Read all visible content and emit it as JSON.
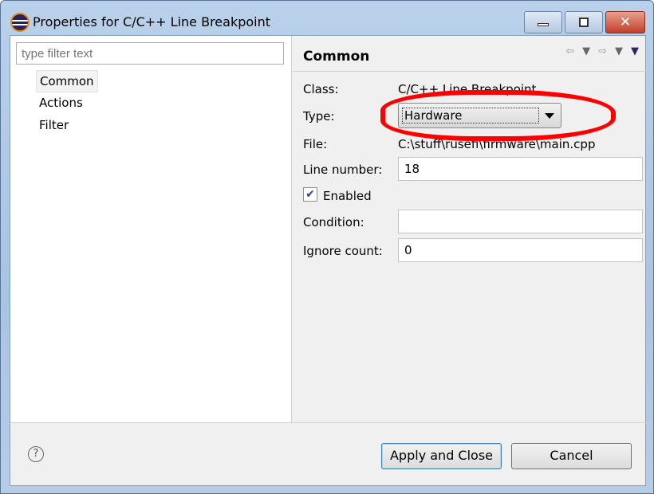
{
  "window": {
    "title": "Properties for C/C++ Line Breakpoint"
  },
  "left": {
    "filter_placeholder": "type filter text",
    "items": [
      "Common",
      "Actions",
      "Filter"
    ],
    "selected": "Common"
  },
  "right": {
    "heading": "Common",
    "class_label": "Class:",
    "class_value": "C/C++ Line Breakpoint",
    "type_label": "Type:",
    "type_value": "Hardware",
    "file_label": "File:",
    "file_value": "C:\\stuff\\rusefi\\firmware\\main.cpp",
    "line_label": "Line number:",
    "line_value": "18",
    "enabled_label": "Enabled",
    "enabled": true,
    "condition_label": "Condition:",
    "condition_value": "",
    "ignore_label": "Ignore count:",
    "ignore_value": "0"
  },
  "buttons": {
    "help": "?",
    "apply": "Apply and Close",
    "cancel": "Cancel"
  },
  "annotation_color": "#ff0000"
}
